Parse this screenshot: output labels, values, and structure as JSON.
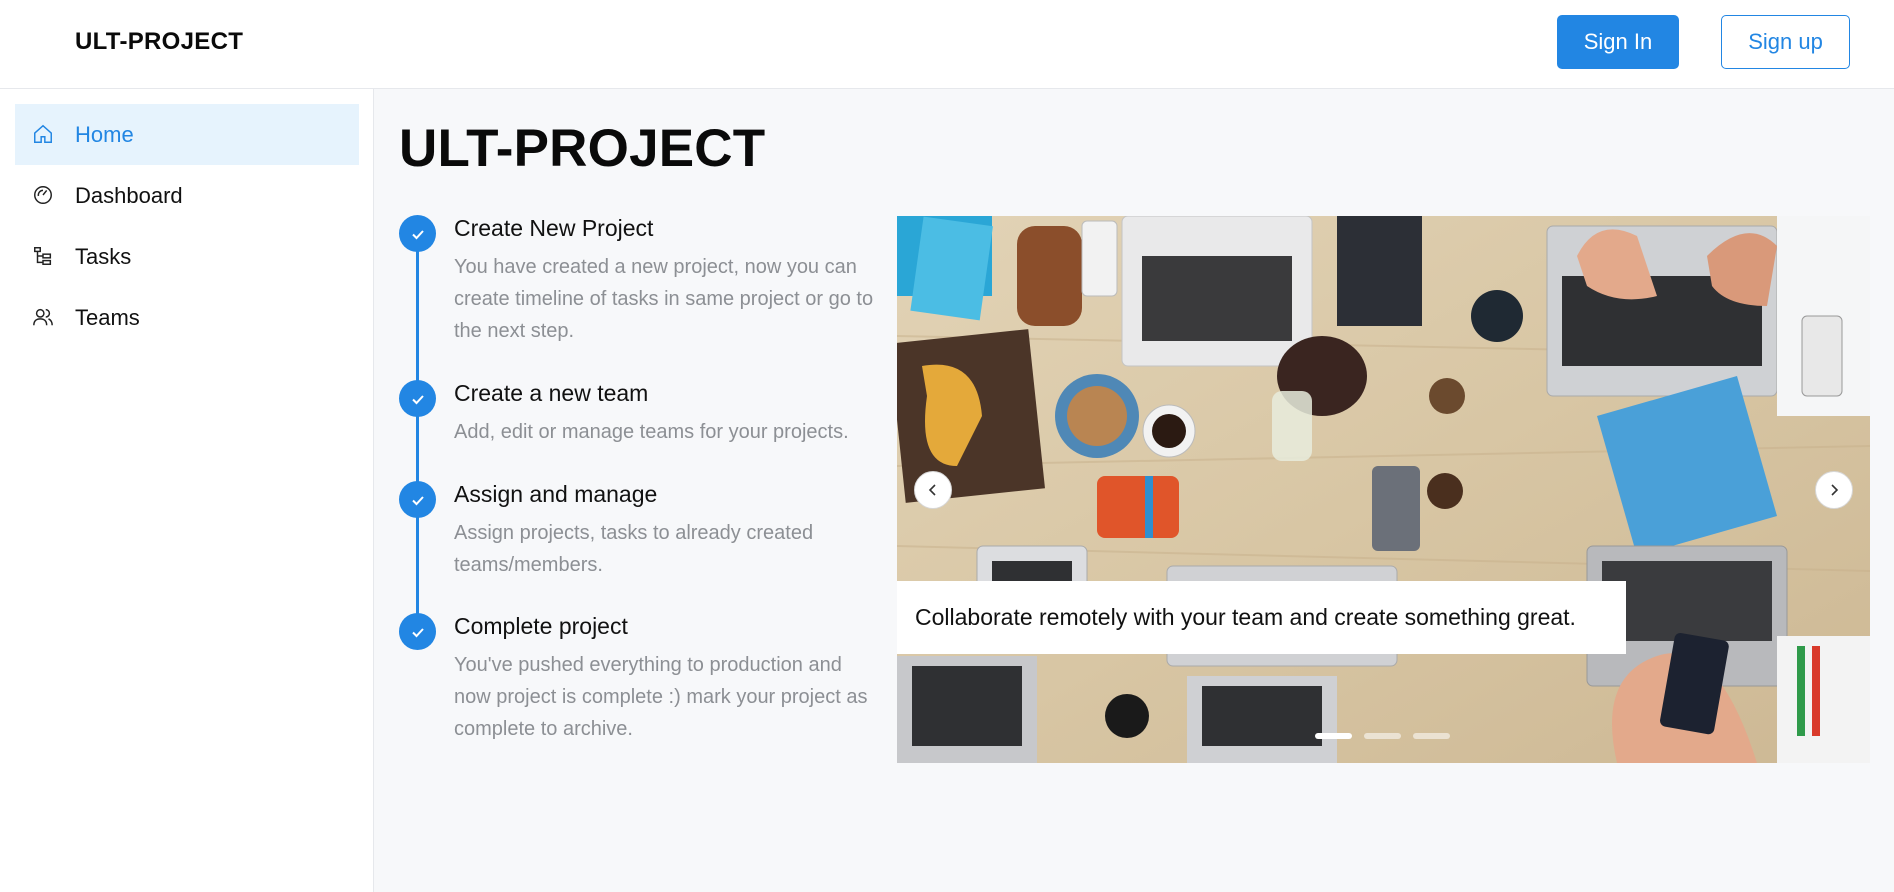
{
  "header": {
    "brand": "ULT-PROJECT",
    "sign_in_label": "Sign In",
    "sign_up_label": "Sign up"
  },
  "sidebar": {
    "items": [
      {
        "label": "Home",
        "icon": "home-icon",
        "active": true
      },
      {
        "label": "Dashboard",
        "icon": "dashboard-icon",
        "active": false
      },
      {
        "label": "Tasks",
        "icon": "tasks-icon",
        "active": false
      },
      {
        "label": "Teams",
        "icon": "teams-icon",
        "active": false
      }
    ]
  },
  "main": {
    "title": "ULT-PROJECT",
    "steps": [
      {
        "title": "Create New Project",
        "description": "You have created a new project, now you can create timeline of tasks in same project or go to the next step."
      },
      {
        "title": "Create a new team",
        "description": "Add, edit or manage teams for your projects."
      },
      {
        "title": "Assign and manage",
        "description": "Assign projects, tasks to already created teams/members."
      },
      {
        "title": "Complete project",
        "description": "You've pushed everything to production and now project is complete :) mark your project as complete to archive."
      }
    ],
    "carousel": {
      "caption": "Collaborate remotely with your team and create something great.",
      "slide_count": 3,
      "active_slide": 1
    }
  },
  "colors": {
    "accent": "#2286e3",
    "active_nav_bg": "#e6f3fd",
    "muted_text": "#8c8f94"
  }
}
